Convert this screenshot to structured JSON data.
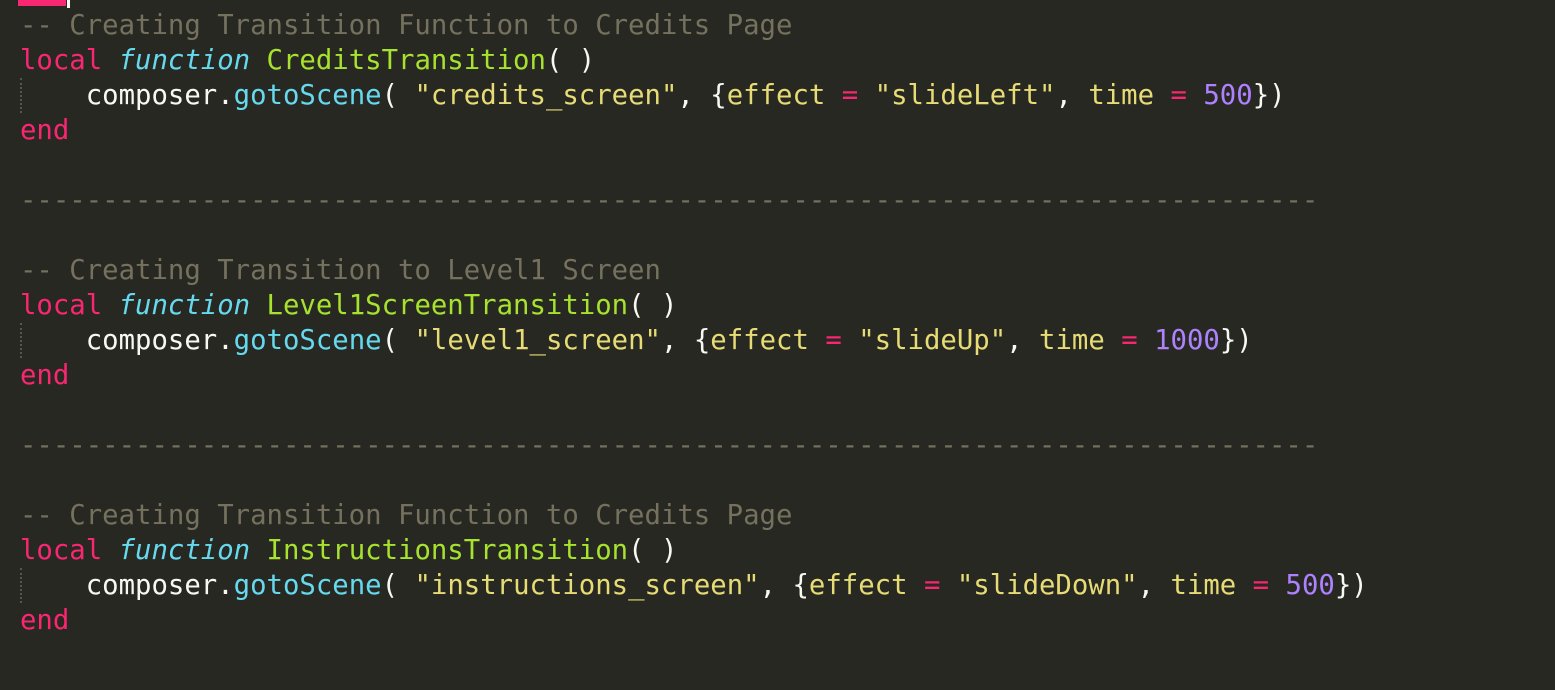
{
  "editor": {
    "theme_colors": {
      "background": "#272822",
      "comment": "#75715e",
      "keyword": "#f92672",
      "storage": "#66d9ef",
      "function_name": "#a6e22e",
      "string": "#e6db74",
      "number": "#ae81ff",
      "plain": "#f8f8f2"
    },
    "blocks": [
      {
        "comment": "-- Creating Transition Function to Credits Page",
        "kw_local": "local",
        "kw_function": "function",
        "name": "CreditsTransition",
        "params": "( )",
        "obj": "composer",
        "dot": ".",
        "method": "gotoScene",
        "open": "( ",
        "scene": "\"credits_screen\"",
        "sep": ", ",
        "brace_open": "{",
        "effect_key": "effect",
        "eq1": " = ",
        "effect_val": "\"slideLeft\"",
        "sep2": ", ",
        "time_key": "time",
        "eq2": " = ",
        "time_val": "500",
        "close": "})",
        "kw_end": "end"
      },
      {
        "comment": "-- Creating Transition to Level1 Screen",
        "kw_local": "local",
        "kw_function": "function",
        "name": "Level1ScreenTransition",
        "params": "( )",
        "obj": "composer",
        "dot": ".",
        "method": "gotoScene",
        "open": "( ",
        "scene": "\"level1_screen\"",
        "sep": ", ",
        "brace_open": "{",
        "effect_key": "effect",
        "eq1": " = ",
        "effect_val": "\"slideUp\"",
        "sep2": ", ",
        "time_key": "time",
        "eq2": " = ",
        "time_val": "1000",
        "close": "})",
        "kw_end": "end"
      },
      {
        "comment": "-- Creating Transition Function to Credits Page",
        "kw_local": "local",
        "kw_function": "function",
        "name": "InstructionsTransition",
        "params": "( )",
        "obj": "composer",
        "dot": ".",
        "method": "gotoScene",
        "open": "( ",
        "scene": "\"instructions_screen\"",
        "sep": ", ",
        "brace_open": "{",
        "effect_key": "effect",
        "eq1": " = ",
        "effect_val": "\"slideDown\"",
        "sep2": ", ",
        "time_key": "time",
        "eq2": " = ",
        "time_val": "500",
        "close": "})",
        "kw_end": "end"
      }
    ],
    "separator": "-------------------------------------------------------------------------------"
  }
}
